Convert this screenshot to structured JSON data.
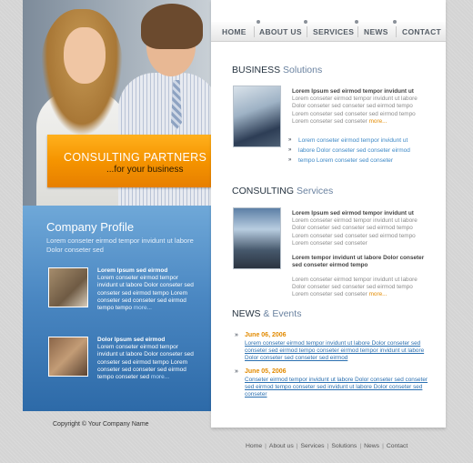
{
  "nav": {
    "items": [
      "HOME",
      "ABOUT US",
      "SERVICES",
      "NEWS",
      "CONTACT"
    ]
  },
  "banner": {
    "title": "CONSULTING PARTNERS",
    "subtitle": "...for your business"
  },
  "profile": {
    "title": "Company Profile",
    "intro": "Lorem conseter eirmod tempor invidunt ut labore Dolor conseter sed",
    "items": [
      {
        "heading": "Lorem Ipsum sed eirmod",
        "body": "Lorem conseter eirmod tempor invidunt ut labore Dolor conseter sed conseter sed eirmod tempo Lorem conseter sed conseter sed eirmod tempo tempo",
        "more": "more..."
      },
      {
        "heading": "Dolor Ipsum sed eirmod",
        "body": "Lorem conseter eirmod tempor invidunt ut labore Dolor conseter sed conseter sed eirmod tempo Lorem conseter sed conseter sed eirmod tempo conseter sed",
        "more": "more..."
      }
    ]
  },
  "business": {
    "title_bold": "BUSINESS",
    "title_light": "Solutions",
    "heading": "Lorem Ipsum sed eirmod tempor invidunt ut",
    "body": "Lorem conseter eirmod tempor invidunt ut labore Dolor conseter sed conseter sed eirmod tempo Lorem conseter sed conseter sed eirmod tempo Lorem conseter sed conseter",
    "more": "more...",
    "links": [
      "Lorem conseter eirmod tempor invidunt ut",
      "labore Dolor conseter sed conseter eirmod",
      "tempo Lorem conseter sed conseter"
    ]
  },
  "consulting": {
    "title_bold": "CONSULTING",
    "title_light": "Services",
    "heading1": "Lorem Ipsum sed eirmod tempor invidunt ut",
    "body1": "Lorem conseter eirmod tempor invidunt ut labore Dolor conseter sed conseter sed eirmod tempo Lorem conseter sed conseter sed eirmod tempo Lorem conseter sed conseter",
    "heading2": "Lorem tempor invidunt ut labore Dolor conseter sed conseter eirmod tempo",
    "body2": "Lorem conseter eirmod tempor invidunt ut labore Dolor conseter sed conseter sed eirmod tempo Lorem conseter sed conseter",
    "more": "more..."
  },
  "news": {
    "title_bold": "NEWS",
    "title_light": "& Events",
    "items": [
      {
        "date": "June 06, 2006",
        "text": "Lorem conseter eirmod tempor invidunt ut labore Dolor conseter sed conseter sed eirmod tempo conseter eirmod tempor invidunt ut labore Dolor conseter sed conseter sed eirmod"
      },
      {
        "date": "June 05, 2006",
        "text": "Conseter eirmod tempor invidunt ut labore Dolor conseter sed conseter sed eirmod tempo conseter sed invidunt ut labore Dolor conseter sed conseter"
      }
    ]
  },
  "footer": {
    "copyright": "Copyright © Your Company Name",
    "links": [
      "Home",
      "About us",
      "Services",
      "Solutions",
      "News",
      "Contact"
    ]
  }
}
